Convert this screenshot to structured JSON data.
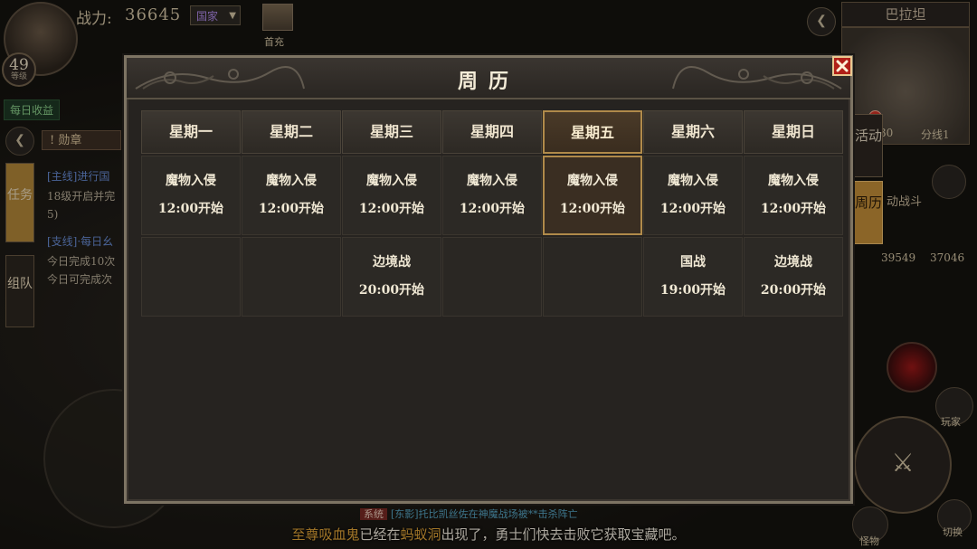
{
  "hud": {
    "level": "49",
    "level_sub": "等级",
    "power_label": "战力:",
    "power_value": "36645",
    "nation_dropdown": "国家",
    "first_charge_label": "首充",
    "daily_income": "每日收益",
    "medal_button": "! 勋章",
    "task_tab": "任务",
    "team_tab": "组队",
    "quests": [
      "[主线]进行国",
      "18级开启并完",
      "5)",
      "[支线]·每日幺",
      "今日完成10次",
      "今日可完成次"
    ],
    "minimap_title": "巴拉坦",
    "minimap_coord": "30",
    "minimap_line": "分线1",
    "activity_button": "活动",
    "calendar_button": "周历",
    "auto_battle": "动战斗",
    "stat_a": "39549",
    "stat_b": "37046",
    "player_label": "玩家",
    "treasure_label": "怪物",
    "switch_label": "切换"
  },
  "chat": {
    "system_tag": "系统",
    "message": "[东影]托比凯丝佐在神魔战场被**击杀阵亡"
  },
  "broadcast": {
    "highlight1": "至尊吸血鬼",
    "text1": "已经在",
    "highlight2": "蚂蚁洞",
    "text2": "出现了，勇士们快去击败它获取宝藏吧。"
  },
  "modal": {
    "title": "周历",
    "days": [
      "星期一",
      "星期二",
      "星期三",
      "星期四",
      "星期五",
      "星期六",
      "星期日"
    ],
    "today_index": 4,
    "row1": [
      {
        "name": "魔物入侵",
        "time": "12:00开始"
      },
      {
        "name": "魔物入侵",
        "time": "12:00开始"
      },
      {
        "name": "魔物入侵",
        "time": "12:00开始"
      },
      {
        "name": "魔物入侵",
        "time": "12:00开始"
      },
      {
        "name": "魔物入侵",
        "time": "12:00开始"
      },
      {
        "name": "魔物入侵",
        "time": "12:00开始"
      },
      {
        "name": "魔物入侵",
        "time": "12:00开始"
      }
    ],
    "row2": [
      {
        "name": "",
        "time": ""
      },
      {
        "name": "",
        "time": ""
      },
      {
        "name": "边境战",
        "time": "20:00开始"
      },
      {
        "name": "",
        "time": ""
      },
      {
        "name": "",
        "time": ""
      },
      {
        "name": "国战",
        "time": "19:00开始"
      },
      {
        "name": "边境战",
        "time": "20:00开始"
      }
    ]
  }
}
